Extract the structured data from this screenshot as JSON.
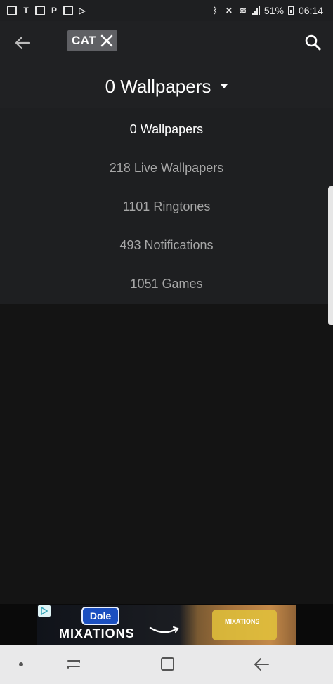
{
  "status_bar": {
    "battery_percent": "51%",
    "time": "06:14"
  },
  "app_bar": {
    "search_chip_label": "CAT"
  },
  "category_selector": {
    "selected_label": "0 Wallpapers"
  },
  "dropdown_menu": {
    "items": [
      {
        "label": "0 Wallpapers",
        "selected": true
      },
      {
        "label": "218 Live Wallpapers",
        "selected": false
      },
      {
        "label": "1101 Ringtones",
        "selected": false
      },
      {
        "label": "493 Notifications",
        "selected": false
      },
      {
        "label": "1051 Games",
        "selected": false
      }
    ]
  },
  "ad": {
    "logo_text": "Dole",
    "brand_text": "MIXATIONS",
    "product_label": "MIXATIONS"
  },
  "icons": {
    "back": "back-arrow-icon",
    "search": "search-icon",
    "chip_close": "close-icon",
    "dropdown": "triangle-down-icon"
  },
  "colors": {
    "background": "#141414",
    "app_bar": "#202123",
    "menu_bg": "#1e1f21",
    "selected_text": "#ffffff",
    "unselected_text": "#a7a7a7",
    "chip_bg": "#5f6064",
    "nav_bar": "#e9e9ea"
  }
}
